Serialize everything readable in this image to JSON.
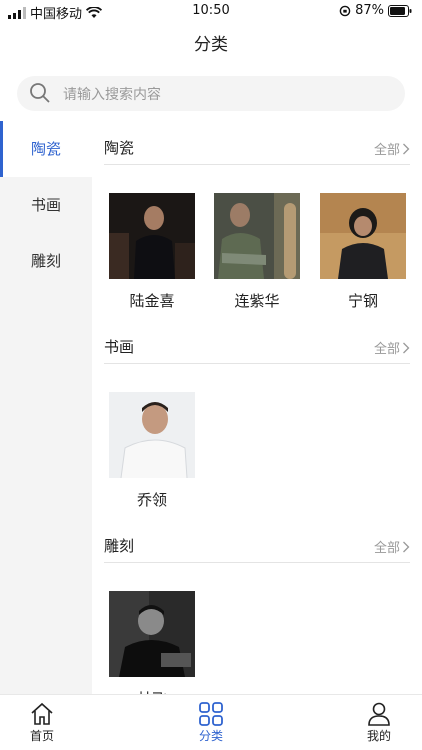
{
  "status": {
    "carrier": "中国移动",
    "time": "10:50",
    "battery": "87%"
  },
  "header": {
    "title": "分类"
  },
  "search": {
    "placeholder": "请输入搜索内容"
  },
  "sidebar": {
    "items": [
      {
        "label": "陶瓷",
        "active": true
      },
      {
        "label": "书画",
        "active": false
      },
      {
        "label": "雕刻",
        "active": false
      }
    ]
  },
  "sections": [
    {
      "title": "陶瓷",
      "all_label": "全部",
      "artists": [
        {
          "name": "陆金喜"
        },
        {
          "name": "连紫华"
        },
        {
          "name": "宁钢"
        }
      ]
    },
    {
      "title": "书画",
      "all_label": "全部",
      "artists": [
        {
          "name": "乔领"
        }
      ]
    },
    {
      "title": "雕刻",
      "all_label": "全部",
      "artists": [
        {
          "name": "林飞"
        }
      ]
    }
  ],
  "tabbar": {
    "items": [
      {
        "label": "首页",
        "icon": "home-icon",
        "active": false
      },
      {
        "label": "分类",
        "icon": "grid-icon",
        "active": true
      },
      {
        "label": "我的",
        "icon": "user-icon",
        "active": false
      }
    ]
  },
  "colors": {
    "accent": "#2f63cf",
    "sidebar_bg": "#f4f4f4"
  }
}
